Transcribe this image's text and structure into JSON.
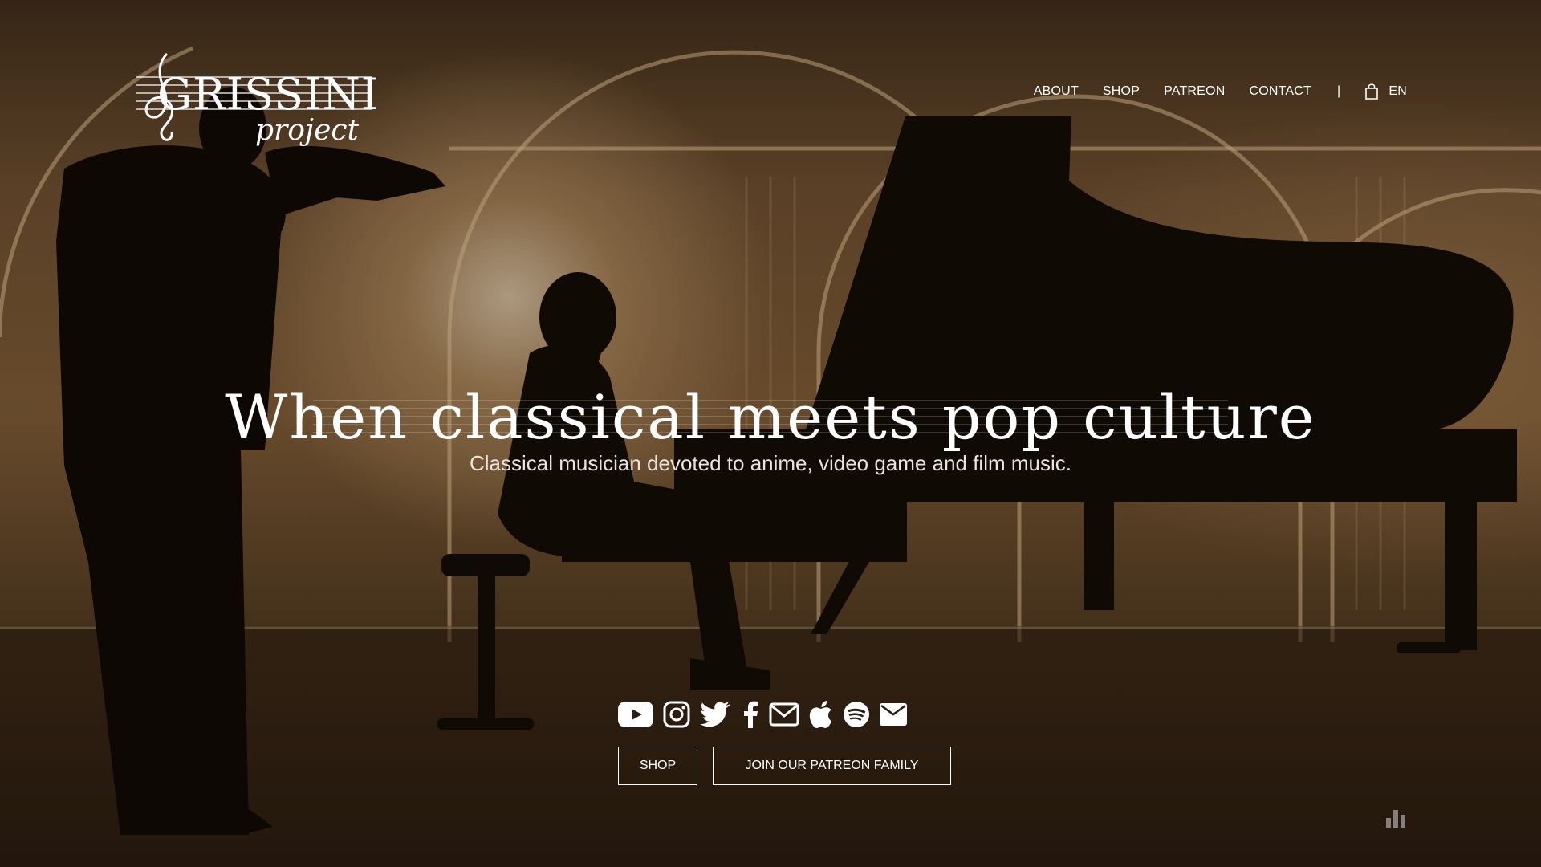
{
  "brand": {
    "logo_main": "GRISSINI",
    "logo_sub": "project"
  },
  "nav": {
    "items": [
      {
        "label": "ABOUT"
      },
      {
        "label": "SHOP"
      },
      {
        "label": "PATREON"
      },
      {
        "label": "CONTACT"
      }
    ],
    "separator": "|",
    "cart_icon": "shopping-bag-icon",
    "language": "EN"
  },
  "hero": {
    "title": "When classical meets pop culture",
    "subtitle": "Classical musician devoted to anime, video game and film music."
  },
  "socials": [
    {
      "icon": "youtube-icon"
    },
    {
      "icon": "instagram-icon"
    },
    {
      "icon": "twitter-icon"
    },
    {
      "icon": "facebook-icon"
    },
    {
      "icon": "email-outline-icon"
    },
    {
      "icon": "apple-icon"
    },
    {
      "icon": "spotify-icon"
    },
    {
      "icon": "email-filled-icon"
    }
  ],
  "buttons": {
    "shop": "SHOP",
    "patreon": "JOIN OUR PATREON FAMILY"
  },
  "colors": {
    "text": "#ffffff",
    "background_warm": "#7c5a36",
    "background_dark": "#1a130b"
  }
}
